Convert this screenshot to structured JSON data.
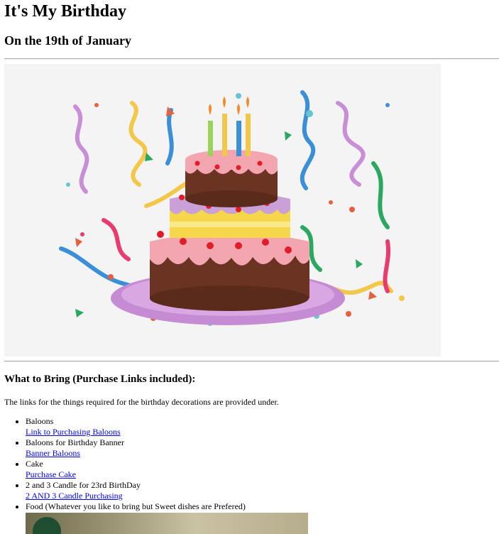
{
  "page": {
    "title": "It's My Birthday",
    "date_line": "On the 19th of January"
  },
  "image": {
    "alt": "birthday cake with candles and confetti",
    "colors": {
      "background": "#f4f4f4",
      "chocolate": "#6b3422",
      "pink_icing": "#f4a6b0",
      "yellow_layer": "#f6d64a",
      "purple_plate": "#c58cd3"
    }
  },
  "bring": {
    "heading": "What to Bring (Purchase Links included):",
    "intro": "The links for the things required for the birthday decorations are provided under.",
    "items": [
      {
        "label": "Baloons",
        "link": "Link to Purchasing Baloons"
      },
      {
        "label": "Baloons for Birthday Banner",
        "link": "Banner Baloons"
      },
      {
        "label": "Cake",
        "link": "Purchase Cake"
      },
      {
        "label": "2 and 3 Candle for 23rd BirthDay",
        "link": "2 AND 3 Candle Purchasing"
      },
      {
        "label": "Food (Whatever you like to bring but Sweet dishes are Prefered)"
      }
    ]
  },
  "colors": {
    "link": "#0000ee",
    "rule": "#aaaaaa"
  }
}
